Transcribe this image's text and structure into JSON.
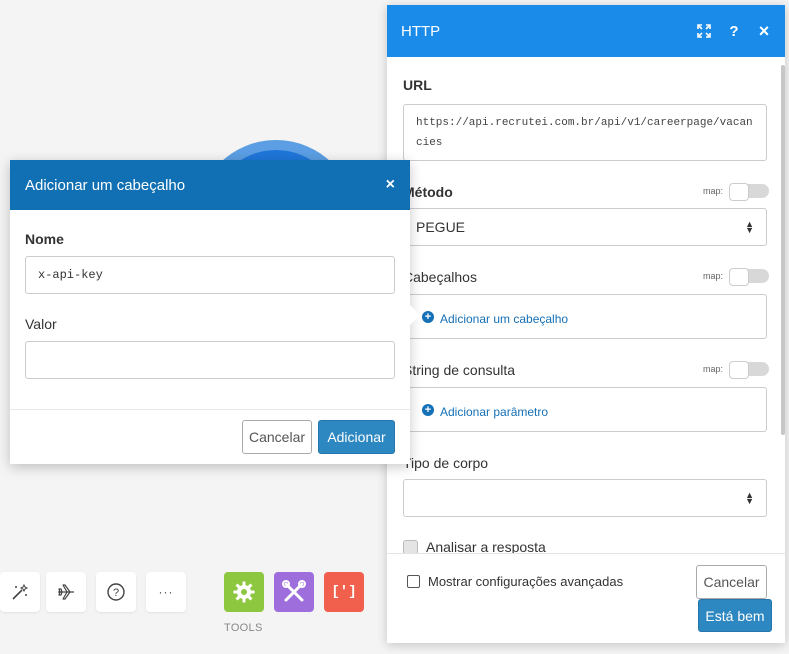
{
  "toolbar": {
    "items": [
      {
        "icon": "magic-wand-icon"
      },
      {
        "icon": "airplane-icon"
      },
      {
        "icon": "question-icon",
        "label": "?"
      },
      {
        "icon": "more-icon",
        "label": "···"
      }
    ],
    "tools": [
      {
        "icon": "gear-icon",
        "color": "#8dc63f"
      },
      {
        "icon": "tools-icon",
        "color": "#9e6fdc"
      },
      {
        "icon": "brackets-icon",
        "label": "[']",
        "color": "#f0604d"
      }
    ],
    "tools_label": "TOOLS"
  },
  "http_panel": {
    "title": "HTTP",
    "header_color": "#1a8be8",
    "icons": [
      "expand-icon",
      "help-icon",
      "close-icon"
    ],
    "help_label": "?",
    "close_label": "×",
    "url": {
      "label": "URL",
      "value": "https://api.recrutei.com.br/api/v1/careerpage/vacancies"
    },
    "method": {
      "label": "Método",
      "map_label": "map:",
      "value": "PEGUE"
    },
    "headers": {
      "label": "Cabeçalhos",
      "map_label": "map:",
      "add_label": "Adicionar um cabeçalho"
    },
    "query": {
      "label": "String de consulta",
      "map_label": "map:",
      "add_label": "Adicionar parâmetro"
    },
    "body_type": {
      "label": "Tipo de corpo",
      "value": ""
    },
    "parse_response": {
      "label": "Analisar a resposta",
      "checked": false
    },
    "advanced": {
      "label": "Mostrar configurações avançadas",
      "checked": false
    },
    "cancel_label": "Cancelar",
    "ok_label": "Está bem"
  },
  "modal": {
    "title": "Adicionar um cabeçalho",
    "header_color": "#1170b4",
    "close_label": "×",
    "name": {
      "label": "Nome",
      "value": "x-api-key"
    },
    "value": {
      "label": "Valor",
      "value": ""
    },
    "cancel_label": "Cancelar",
    "add_label": "Adicionar"
  }
}
